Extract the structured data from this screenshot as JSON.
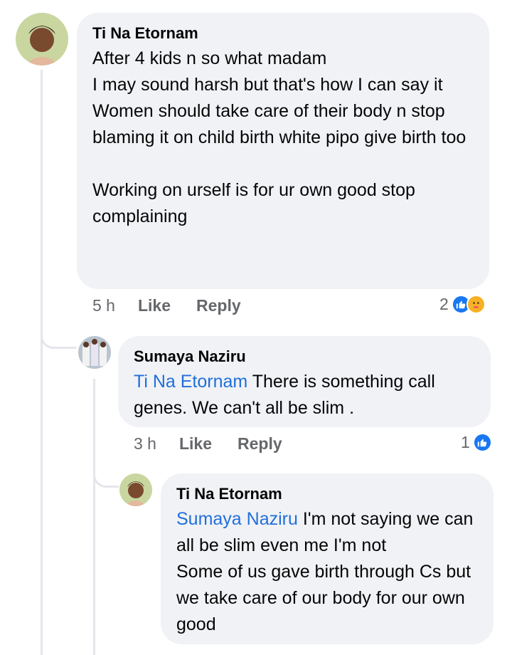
{
  "comments": [
    {
      "author": "Ti Na Etornam",
      "lines": [
        "After 4 kids n so what madam",
        "I may sound harsh but that's how I can say it",
        "Women should take care of their body n stop blaming it on child birth white pipo give birth too",
        "",
        "Working on urself is for ur own good stop complaining"
      ],
      "time": "5 h",
      "like_label": "Like",
      "reply_label": "Reply",
      "reaction_count": "2",
      "reactions": [
        "like-icon",
        "care-icon"
      ]
    },
    {
      "author": "Sumaya Naziru",
      "mention": "Ti Na Etornam",
      "text_1": " There is something call genes. We can't all be slim .",
      "time": "3 h",
      "like_label": "Like",
      "reply_label": "Reply",
      "reaction_count": "1",
      "reactions": [
        "like-icon"
      ]
    },
    {
      "author": "Ti Na Etornam",
      "mention": "Sumaya Naziru",
      "text_1": " I'm not saying we can all be slim even me I'm not",
      "text_2": "Some of us gave birth through Cs but we take care of our body for our own good"
    }
  ],
  "colors": {
    "bubble": "#f0f2f5",
    "mention": "#216fdb",
    "meta": "#65676b",
    "like": "#1877f2"
  }
}
